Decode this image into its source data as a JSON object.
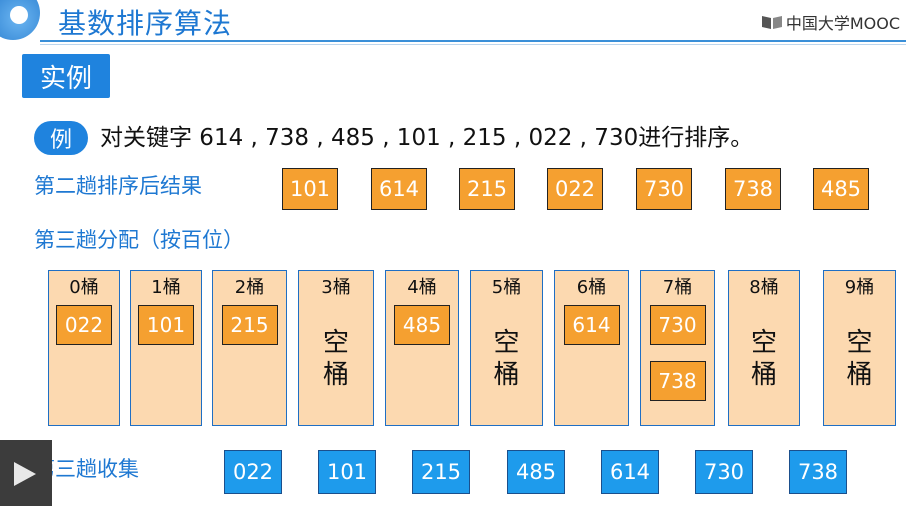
{
  "header": {
    "title": "基数排序算法",
    "brand": "中国大学MOOC"
  },
  "section_tag": "实例",
  "example": {
    "pill": "例",
    "text": "对关键字 614 , 738 , 485 , 101 , 215 , 022 , 730进行排序。"
  },
  "pass2_result": {
    "label": "第二趟排序后结果",
    "values": [
      "101",
      "614",
      "215",
      "022",
      "730",
      "738",
      "485"
    ]
  },
  "pass3_distribute": {
    "label": "第三趟分配（按百位）",
    "buckets": [
      {
        "label": "0桶",
        "items": [
          "022"
        ],
        "empty": ""
      },
      {
        "label": "1桶",
        "items": [
          "101"
        ],
        "empty": ""
      },
      {
        "label": "2桶",
        "items": [
          "215"
        ],
        "empty": ""
      },
      {
        "label": "3桶",
        "items": [],
        "empty": "空\n桶"
      },
      {
        "label": "4桶",
        "items": [
          "485"
        ],
        "empty": ""
      },
      {
        "label": "5桶",
        "items": [],
        "empty": "空\n桶"
      },
      {
        "label": "6桶",
        "items": [
          "614"
        ],
        "empty": ""
      },
      {
        "label": "7桶",
        "items": [
          "730",
          "738"
        ],
        "empty": ""
      },
      {
        "label": "8桶",
        "items": [],
        "empty": "空\n桶"
      },
      {
        "label": "9桶",
        "items": [],
        "empty": "空\n桶"
      }
    ]
  },
  "pass3_collect": {
    "label": "第三趟收集",
    "values": [
      "022",
      "101",
      "215",
      "485",
      "614",
      "730",
      "738"
    ]
  },
  "icons": {
    "play": "play-icon",
    "brand": "mooc-book-icon"
  },
  "colors": {
    "accent_blue": "#1e78d2",
    "orange": "#f5a030",
    "bucket_fill": "#fcd9b0",
    "collect_blue": "#1e9bec"
  }
}
